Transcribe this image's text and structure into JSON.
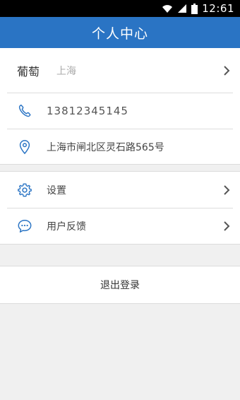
{
  "status_bar": {
    "time": "12:61"
  },
  "header": {
    "title": "个人中心"
  },
  "profile": {
    "name": "葡萄",
    "city": "上海",
    "phone": "13812345145",
    "address": "上海市闸北区灵石路565号"
  },
  "menu": {
    "items": [
      {
        "label": "设置",
        "icon": "gear-icon"
      },
      {
        "label": "用户反馈",
        "icon": "chat-bubble-icon"
      }
    ]
  },
  "logout": {
    "label": "退出登录"
  },
  "colors": {
    "accent": "#2a74c4",
    "icon": "#2a74c4",
    "background": "#f0f0f0"
  }
}
